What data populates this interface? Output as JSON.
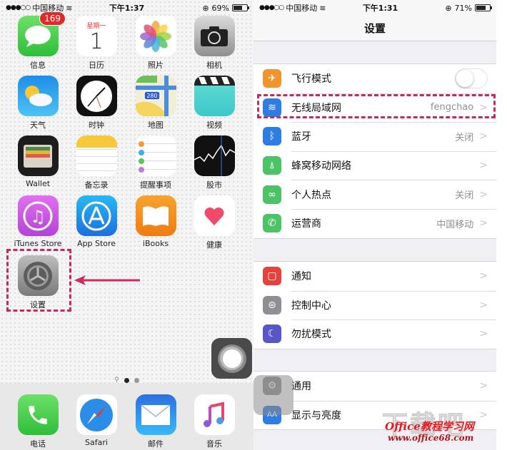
{
  "home": {
    "status": {
      "signal": "●●●○○",
      "carrier": "中国移动",
      "time": "下午1:37",
      "battery": "69%",
      "battery_level": 0.69
    },
    "apps": [
      {
        "label": "信息",
        "icon": "messages-icon",
        "badge": "169"
      },
      {
        "label": "日历",
        "icon": "calendar-icon",
        "weekday": "星期一",
        "day": "1"
      },
      {
        "label": "照片",
        "icon": "photos-icon"
      },
      {
        "label": "相机",
        "icon": "camera-icon"
      },
      {
        "label": "天气",
        "icon": "weather-icon"
      },
      {
        "label": "时钟",
        "icon": "clock-icon"
      },
      {
        "label": "地图",
        "icon": "maps-icon",
        "route": "280"
      },
      {
        "label": "视频",
        "icon": "videos-icon"
      },
      {
        "label": "Wallet",
        "icon": "wallet-icon"
      },
      {
        "label": "备忘录",
        "icon": "notes-icon"
      },
      {
        "label": "提醒事项",
        "icon": "reminders-icon"
      },
      {
        "label": "股市",
        "icon": "stocks-icon"
      },
      {
        "label": "iTunes Store",
        "icon": "itunes-store-icon"
      },
      {
        "label": "App Store",
        "icon": "app-store-icon"
      },
      {
        "label": "iBooks",
        "icon": "ibooks-icon"
      },
      {
        "label": "健康",
        "icon": "health-icon"
      },
      {
        "label": "设置",
        "icon": "settings-gear-icon"
      }
    ],
    "dock": [
      {
        "label": "电话",
        "icon": "phone-icon"
      },
      {
        "label": "Safari",
        "icon": "safari-icon"
      },
      {
        "label": "邮件",
        "icon": "mail-icon"
      },
      {
        "label": "音乐",
        "icon": "music-icon"
      }
    ],
    "pages": {
      "current": 1,
      "total": 2
    }
  },
  "settings": {
    "status": {
      "signal": "●●●○○",
      "carrier": "中国移动",
      "time": "下午1:31",
      "battery": "71%",
      "battery_level": 0.71
    },
    "title": "设置",
    "group1": [
      {
        "label": "飞行模式",
        "icon": "airplane-icon",
        "color": "#f0952e",
        "toggle": false
      },
      {
        "label": "无线局域网",
        "icon": "wifi-icon",
        "color": "#2e7de2",
        "value": "fengchao"
      },
      {
        "label": "蓝牙",
        "icon": "bluetooth-icon",
        "color": "#2e7de2",
        "value": "关闭"
      },
      {
        "label": "蜂窝移动网络",
        "icon": "cellular-icon",
        "color": "#4cc364",
        "value": ""
      },
      {
        "label": "个人热点",
        "icon": "hotspot-icon",
        "color": "#4cc364",
        "value": "关闭"
      },
      {
        "label": "运营商",
        "icon": "carrier-phone-icon",
        "color": "#4cc364",
        "value": "中国移动"
      }
    ],
    "group2": [
      {
        "label": "通知",
        "icon": "notifications-icon",
        "color": "#e5423c"
      },
      {
        "label": "控制中心",
        "icon": "control-center-icon",
        "color": "#8e8e93"
      },
      {
        "label": "勿扰模式",
        "icon": "moon-icon",
        "color": "#5856c8"
      }
    ],
    "group3": [
      {
        "label": "通用",
        "icon": "general-gear-icon",
        "color": "#8e8e93"
      },
      {
        "label": "显示与亮度",
        "icon": "display-icon",
        "color": "#2e7de2"
      }
    ],
    "chevron": ">"
  },
  "watermark": {
    "big": "下载吧",
    "line1": "Office教程学习网",
    "line2": "www.office68.com"
  }
}
